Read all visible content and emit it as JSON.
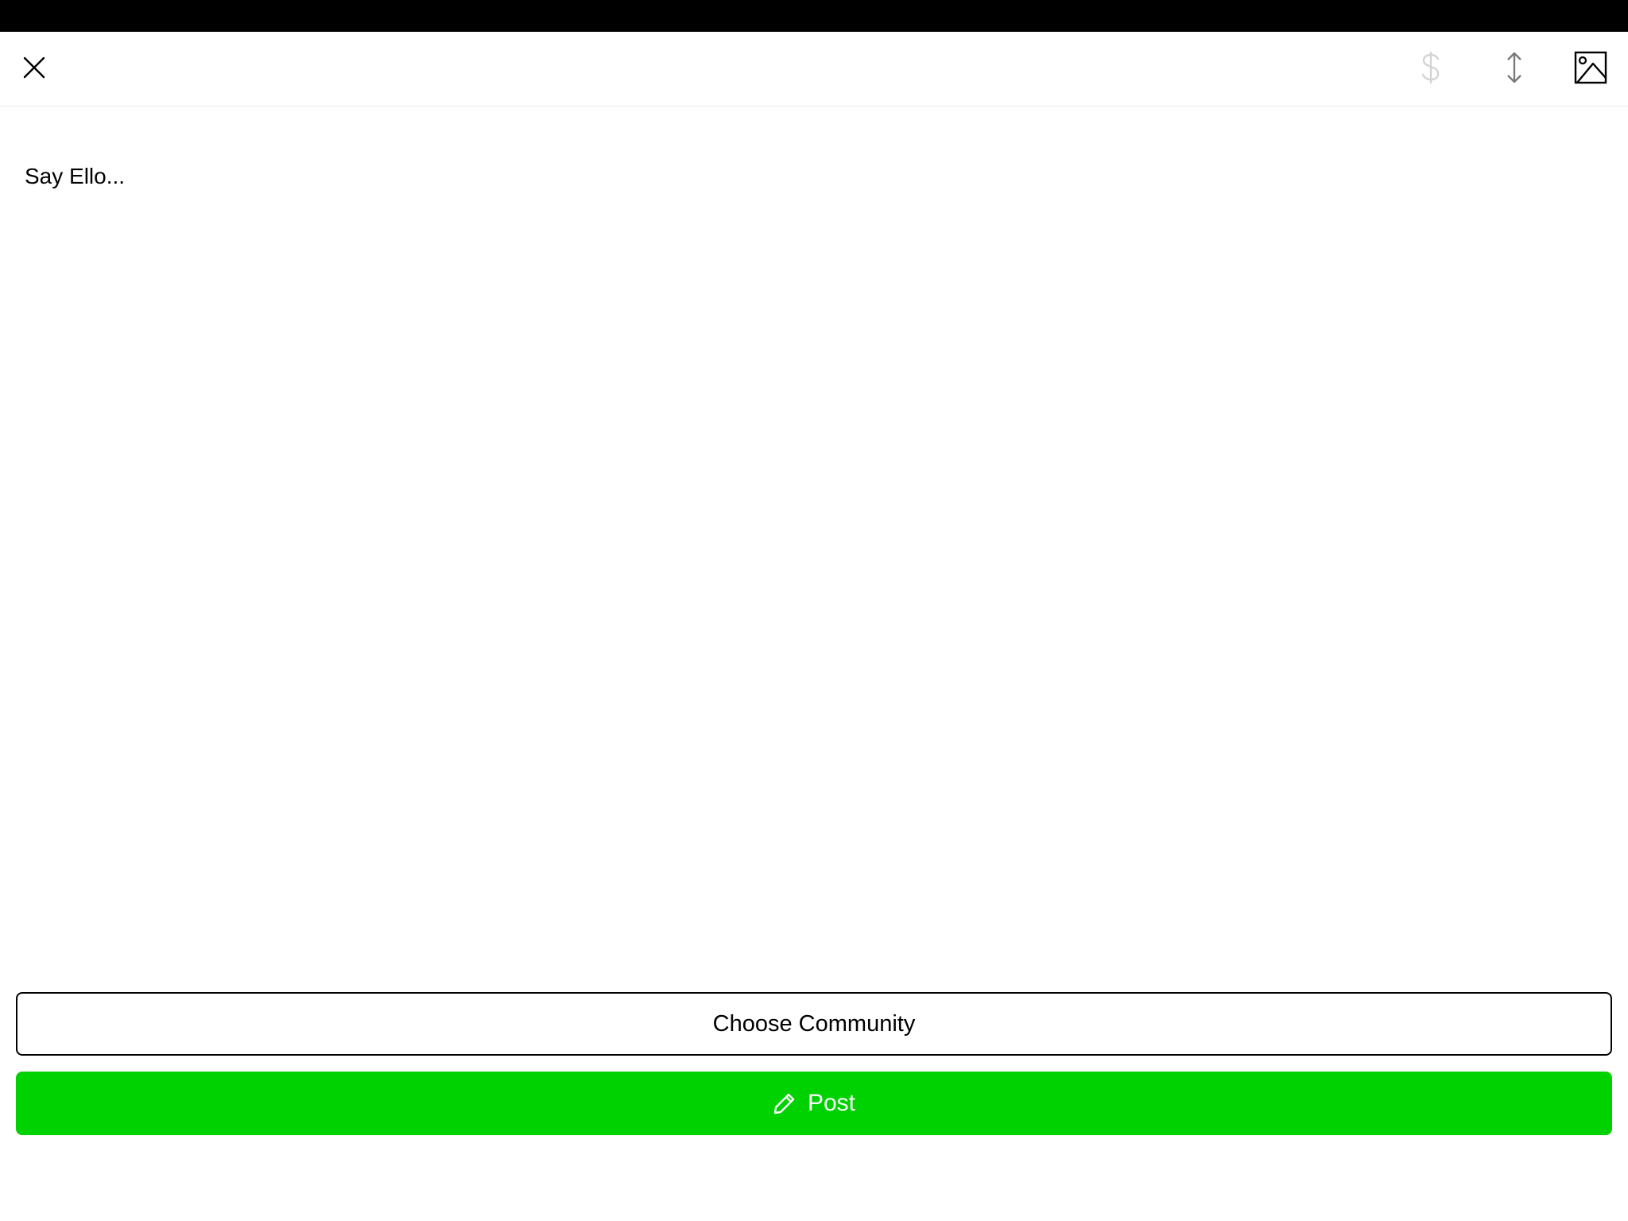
{
  "toolbar": {
    "close_icon": "close-icon",
    "money_icon": "dollar-icon",
    "resize_icon": "vertical-resize-icon",
    "image_icon": "image-icon",
    "money_color": "#d3d3d3",
    "resize_color": "#7a7a7a"
  },
  "composer": {
    "placeholder": "Say Ello..."
  },
  "actions": {
    "community_label": "Choose Community",
    "post_label": "Post",
    "post_icon": "pencil-icon",
    "post_color": "#00d100"
  }
}
